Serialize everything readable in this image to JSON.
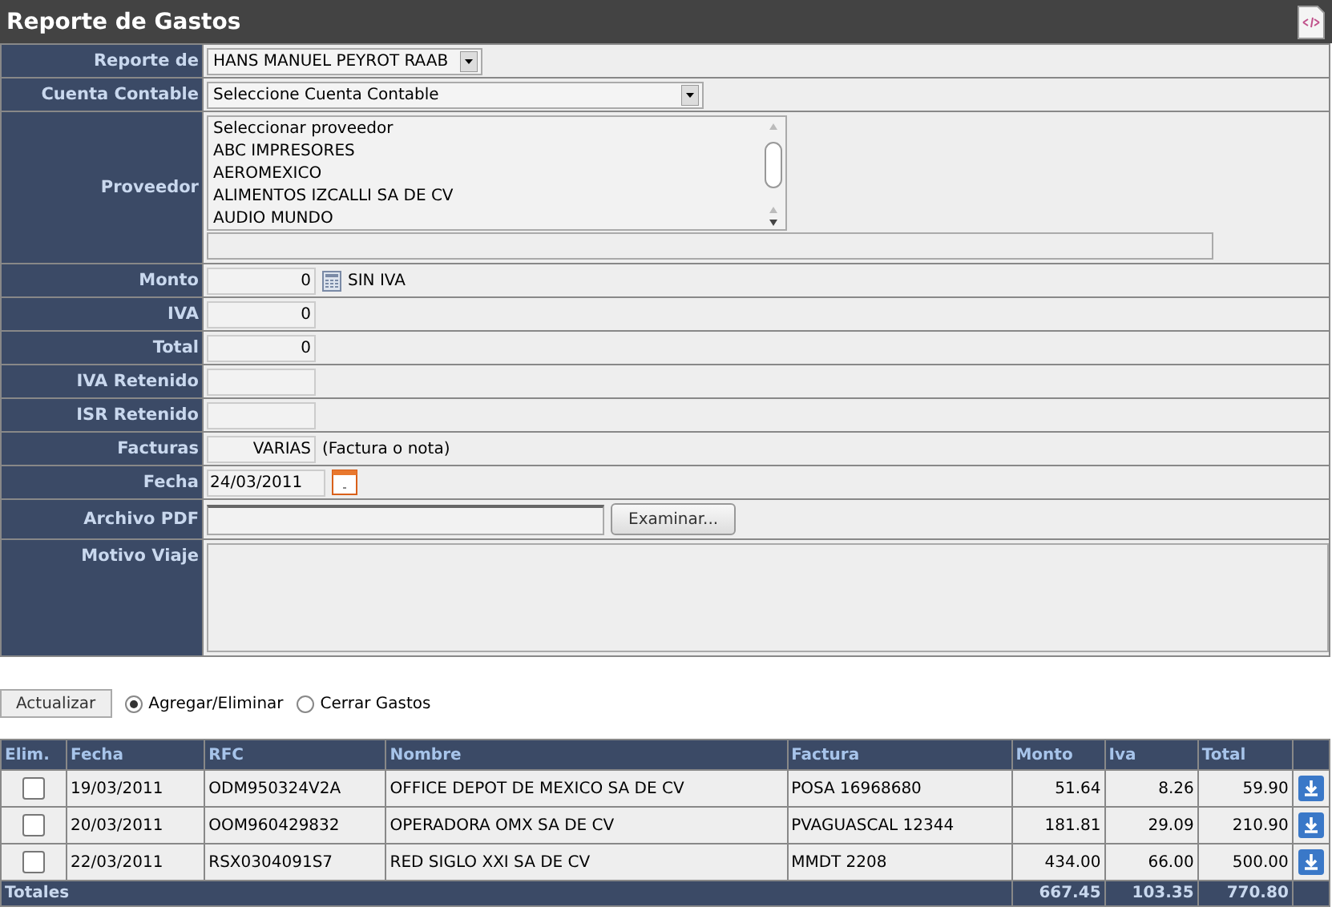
{
  "title": "Reporte de Gastos",
  "form": {
    "fields": [
      {
        "label": "Reporte de",
        "kind": "select",
        "value": "HANS MANUEL PEYROT RAAB"
      },
      {
        "label": "Cuenta Contable",
        "kind": "select",
        "value": "Seleccione Cuenta Contable"
      },
      {
        "label": "Proveedor",
        "kind": "listbox",
        "options": [
          "Seleccionar proveedor",
          "ABC IMPRESORES",
          "AEROMEXICO",
          "ALIMENTOS IZCALLI SA DE CV",
          "AUDIO MUNDO"
        ]
      },
      {
        "label": "Monto",
        "kind": "amount",
        "value": "0",
        "suffix": "SIN IVA"
      },
      {
        "label": "IVA",
        "kind": "number",
        "value": "0"
      },
      {
        "label": "Total",
        "kind": "number",
        "value": "0"
      },
      {
        "label": "IVA Retenido",
        "kind": "number"
      },
      {
        "label": "ISR Retenido",
        "kind": "number"
      },
      {
        "label": "Facturas",
        "kind": "number",
        "value": "VARIAS",
        "suffix": "(Factura o nota)"
      },
      {
        "label": "Fecha",
        "kind": "date",
        "value": "24/03/2011"
      },
      {
        "label": "Archivo PDF",
        "kind": "file",
        "button": "Examinar..."
      },
      {
        "label": "Motivo Viaje",
        "kind": "textarea"
      }
    ]
  },
  "actions": {
    "button": "Actualizar",
    "radios": [
      {
        "label": "Agregar/Eliminar",
        "selected": true
      },
      {
        "label": "Cerrar Gastos",
        "selected": false
      }
    ]
  },
  "table": {
    "columns": [
      "Elim.",
      "Fecha",
      "RFC",
      "Nombre",
      "Factura",
      "Monto",
      "Iva",
      "Total"
    ],
    "rows": [
      {
        "cells": [
          {
            "kind": "checkbox",
            "checked": false
          },
          "19/03/2011",
          "ODM950324V2A",
          "OFFICE DEPOT DE MEXICO SA DE CV",
          "POSA 16968680",
          "51.64",
          "8.26",
          "59.90"
        ]
      },
      {
        "cells": [
          {
            "kind": "checkbox",
            "checked": false
          },
          "20/03/2011",
          "OOM960429832",
          "OPERADORA OMX SA DE CV",
          "PVAGUASCAL 12344",
          "181.81",
          "29.09",
          "210.90"
        ]
      },
      {
        "cells": [
          {
            "kind": "checkbox",
            "checked": false
          },
          "22/03/2011",
          "RSX0304091S7",
          "RED SIGLO XXI SA DE CV",
          "MMDT 2208",
          "434.00",
          "66.00",
          "500.00"
        ]
      }
    ],
    "totals": {
      "label": "Totales",
      "values": [
        "667.45",
        "103.35",
        "770.80"
      ]
    }
  }
}
